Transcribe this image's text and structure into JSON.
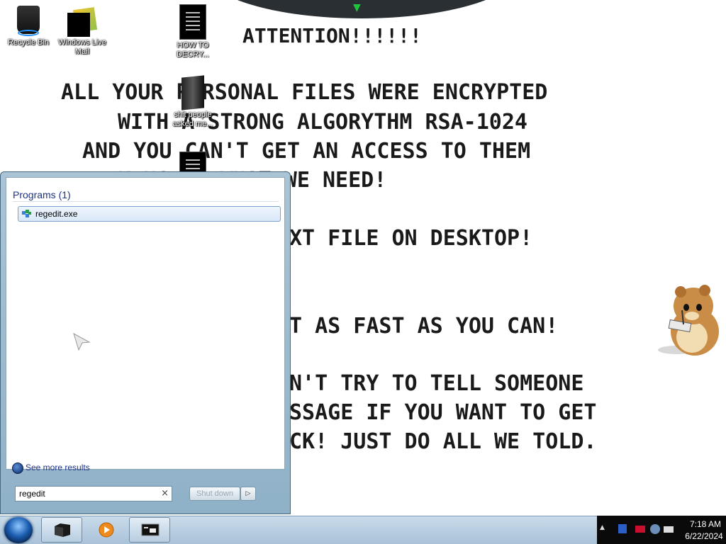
{
  "desktop": {
    "message": {
      "attention": "ATTENTION!!!!!!",
      "line1": "ALL YOUR PERSONAL FILES WERE ENCRYPTED",
      "line2": "WITH A STRONG ALGORYTHM RSA-1024",
      "line3": "AND YOU CAN'T GET AN ACCESS TO THEM",
      "line4": "KING OF WHAT WE NEED!",
      "line5": "XT FILE ON DESKTOP!",
      "line6": "T AS FAST AS YOU CAN!",
      "line7": "N'T TRY TO TELL SOMEONE",
      "line8": "SSAGE IF YOU WANT TO GET",
      "line9": "CK! JUST DO ALL WE TOLD."
    },
    "icons": [
      {
        "label": "Recycle Bin",
        "icon": "recycle-bin-icon"
      },
      {
        "label": "Windows Live Mail",
        "icon": "mail-icon"
      },
      {
        "label": "HOW TO DECRY...",
        "icon": "text-document-icon"
      },
      {
        "label": "shit people asked me...",
        "icon": "folder-icon"
      },
      {
        "label": "",
        "icon": "text-document-icon"
      }
    ]
  },
  "start_menu": {
    "programs_header": "Programs (1)",
    "result": {
      "label": "regedit.exe",
      "icon": "regedit-icon"
    },
    "see_more": "See more results",
    "search": {
      "value": "regedit",
      "clear_glyph": "×"
    },
    "shutdown_label": "Shut down",
    "shutdown_arrow": "▷"
  },
  "taskbar": {
    "buttons": [
      {
        "name": "explorer",
        "icon": "folder-icon"
      },
      {
        "name": "media-player",
        "icon": "media-player-icon"
      },
      {
        "name": "command-prompt",
        "icon": "cmd-icon"
      }
    ],
    "tray": {
      "arrow": "▲",
      "time": "7:18 AM",
      "date": "6/22/2024"
    }
  },
  "colors": {
    "programs_header": "#1e3287",
    "taskbar": "#b7cde0",
    "tray": "#0a0a0a",
    "message_text": "#1a1a1a"
  }
}
